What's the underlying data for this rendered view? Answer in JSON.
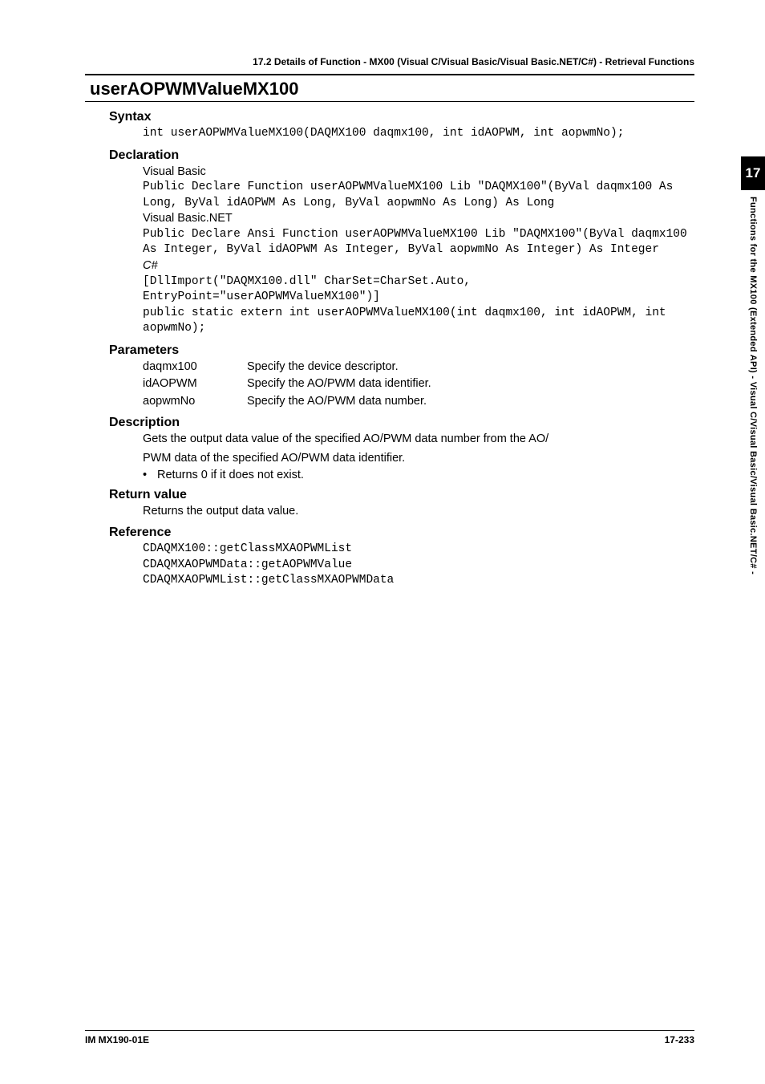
{
  "header": {
    "section_title": "17.2  Details of  Function - MX00 (Visual C/Visual Basic/Visual Basic.NET/C#) - Retrieval Functions"
  },
  "function": {
    "name": "userAOPWMValueMX100"
  },
  "syntax": {
    "heading": "Syntax",
    "code": "int userAOPWMValueMX100(DAQMX100 daqmx100, int idAOPWM, int aopwmNo);"
  },
  "declaration": {
    "heading": "Declaration",
    "vb_label": "Visual Basic",
    "vb_code": "Public Declare Function userAOPWMValueMX100 Lib \"DAQMX100\"(ByVal daqmx100 As Long, ByVal idAOPWM As Long, ByVal aopwmNo As Long) As Long",
    "vbnet_label": "Visual Basic.NET",
    "vbnet_code": "Public Declare Ansi Function userAOPWMValueMX100 Lib \"DAQMX100\"(ByVal daqmx100 As Integer, ByVal idAOPWM As Integer, ByVal aopwmNo As Integer) As Integer",
    "cs_label": "C#",
    "cs_code": "[DllImport(\"DAQMX100.dll\" CharSet=CharSet.Auto, EntryPoint=\"userAOPWMValueMX100\")]\npublic static extern int userAOPWMValueMX100(int daqmx100, int idAOPWM, int aopwmNo);"
  },
  "parameters": {
    "heading": "Parameters",
    "rows": [
      {
        "name": "daqmx100",
        "desc": "Specify the device descriptor."
      },
      {
        "name": "idAOPWM",
        "desc": "Specify the AO/PWM data identifier."
      },
      {
        "name": "aopwmNo",
        "desc": "Specify the AO/PWM data number."
      }
    ]
  },
  "description": {
    "heading": "Description",
    "line1": "Gets the output data value of the specified AO/PWM data number from the AO/",
    "line2": "PWM data of the specified AO/PWM data identifier.",
    "bullet": "Returns 0 if it does not exist."
  },
  "return_value": {
    "heading": "Return value",
    "text": "Returns the output data value."
  },
  "reference": {
    "heading": "Reference",
    "code": "CDAQMX100::getClassMXAOPWMList\nCDAQMXAOPWMData::getAOPWMValue\nCDAQMXAOPWMList::getClassMXAOPWMData"
  },
  "sidebar": {
    "chapter": "17",
    "text": "Functions for the MX100 (Extended API)  -  Visual C/Visual Basic/Visual Basic.NET/C#  -"
  },
  "footer": {
    "left": "IM MX190-01E",
    "right": "17-233"
  }
}
